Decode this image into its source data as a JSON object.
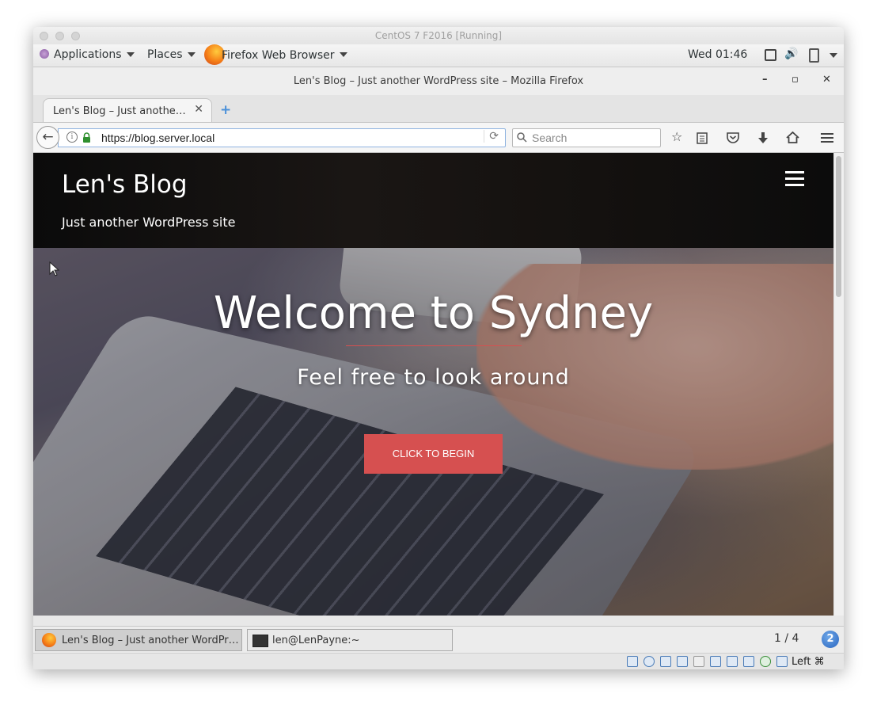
{
  "vm_window": {
    "title": "CentOS 7 F2016 [Running]"
  },
  "gnome_top_bar": {
    "applications": "Applications",
    "places": "Places",
    "active_app": "Firefox Web Browser",
    "clock": "Wed 01:46"
  },
  "firefox": {
    "window_title": "Len's Blog – Just another WordPress site – Mozilla Firefox",
    "minimize": "–",
    "maximize": "▫",
    "close": "✕",
    "tab_label": "Len's Blog – Just anothe…",
    "tab_close": "✕",
    "new_tab": "+",
    "url": "https://blog.server.local",
    "search_placeholder": "Search"
  },
  "site": {
    "title": "Len's Blog",
    "description": "Just another WordPress site",
    "hero_title": "Welcome to Sydney",
    "hero_subtitle": "Feel free to look around",
    "cta_label": "CLICK TO BEGIN",
    "accent_color": "#d65050"
  },
  "taskbar": {
    "task1": "Len's Blog – Just another WordPr…",
    "task2": "len@LenPayne:~",
    "pager": "1 / 4",
    "help": "2"
  },
  "vbox_status": {
    "host_key": "Left ⌘"
  },
  "icons": [
    "back-arrow-icon",
    "info-icon",
    "lock-icon",
    "reload-icon",
    "search-icon",
    "bookmark-star-icon",
    "reading-list-icon",
    "pocket-icon",
    "download-icon",
    "home-icon",
    "menu-icon",
    "hamburger-icon",
    "firefox-icon",
    "terminal-icon",
    "battery-icon",
    "volume-icon",
    "screen-icon"
  ]
}
